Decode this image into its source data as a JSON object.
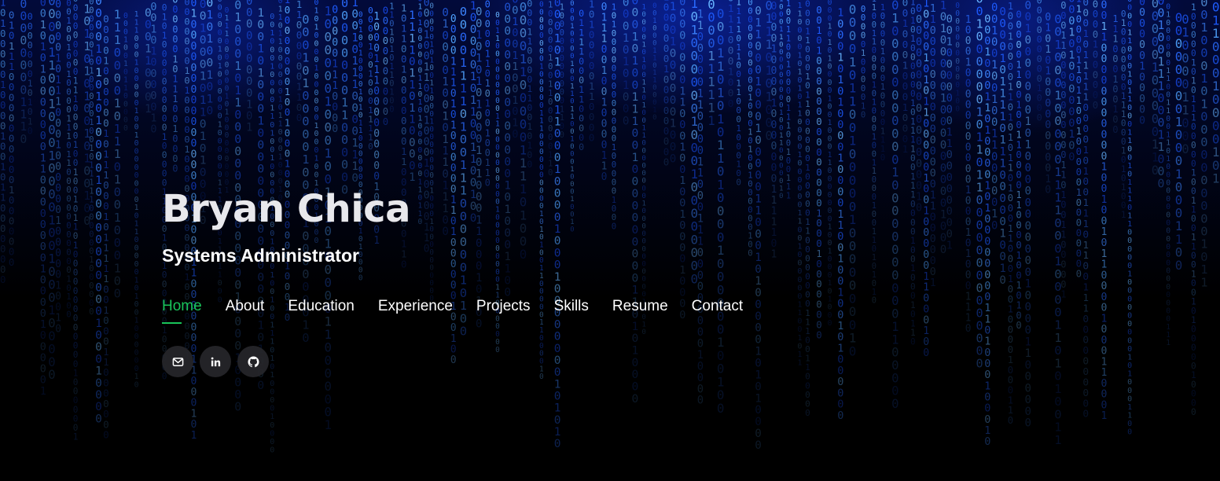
{
  "hero": {
    "name": "Bryan Chica",
    "role": "Systems Administrator"
  },
  "nav": {
    "items": [
      "Home",
      "About",
      "Education",
      "Experience",
      "Projects",
      "Skills",
      "Resume",
      "Contact"
    ],
    "active": "Home",
    "active_color": "#19c45a"
  },
  "social": {
    "icons": [
      "mail-icon",
      "linkedin-icon",
      "github-icon"
    ]
  },
  "background": {
    "digits": [
      "0",
      "1"
    ],
    "accent": "#1e5cff",
    "glow": "#66b3ff"
  }
}
